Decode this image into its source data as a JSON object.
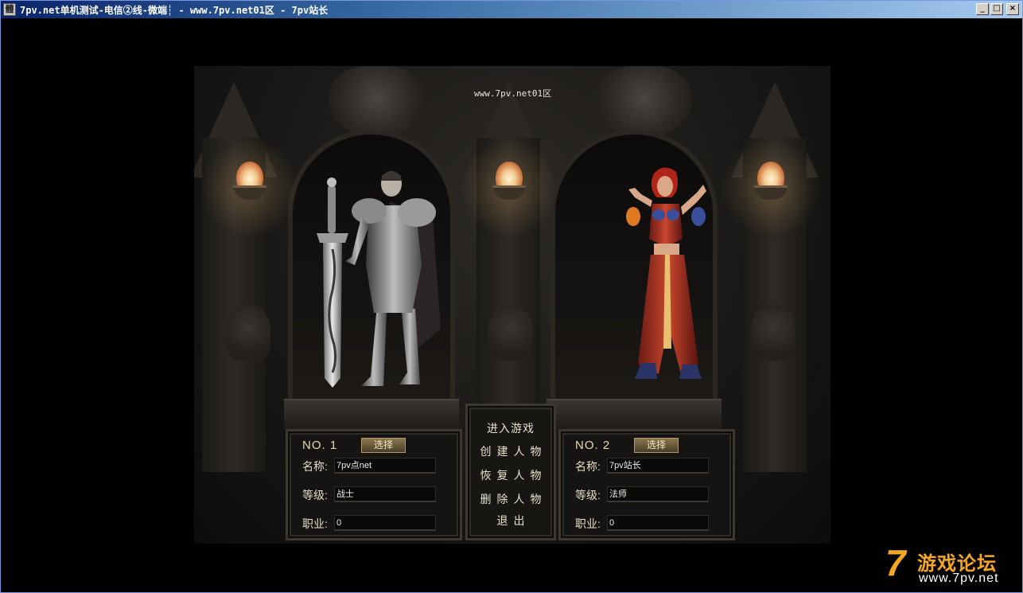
{
  "window": {
    "title": "7pv.net单机测试-电信②线-微端┆ - www.7pv.net01区 - 7pv站长",
    "icon_char": "體",
    "buttons": {
      "minimize": "_",
      "maximize": "□",
      "close": "×"
    }
  },
  "scene": {
    "server_name": "www.7pv.net01区"
  },
  "characters": [
    {
      "slot_label": "NO. 1",
      "select_label": "选择",
      "name_label": "名称:",
      "name_value": "7pv点net",
      "level_label": "等级:",
      "level_value": "战士",
      "job_label": "职业:",
      "job_value": "0"
    },
    {
      "slot_label": "NO. 2",
      "select_label": "选择",
      "name_label": "名称:",
      "name_value": "7pv站长",
      "level_label": "等级:",
      "level_value": "法师",
      "job_label": "职业:",
      "job_value": "0"
    }
  ],
  "menu": {
    "enter_game": "进入游戏",
    "create_character": "创建人物",
    "restore_character": "恢复人物",
    "delete_character": "删除人物",
    "exit": "退出"
  },
  "watermark": {
    "seven": "7",
    "title": "游戏论坛",
    "url": "www.7pv.net",
    "color": "#f5a623"
  }
}
